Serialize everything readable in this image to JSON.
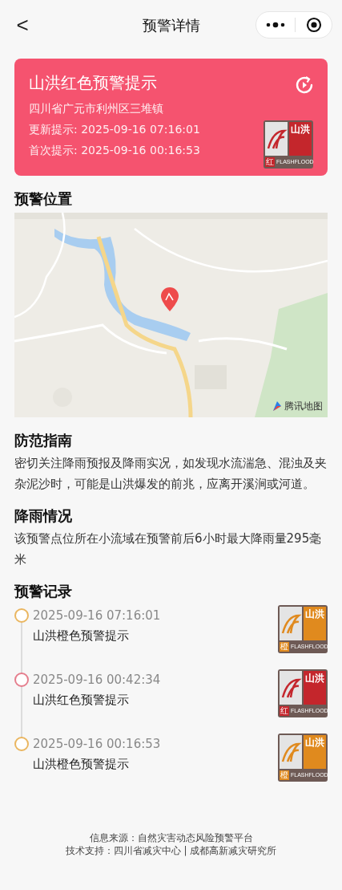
{
  "nav": {
    "back": "<",
    "title": "预警详情"
  },
  "alert": {
    "kind": "red",
    "title": "山洪红色预警提示",
    "location": "四川省广元市利州区三堆镇",
    "updated": "更新提示: 2025-09-16 07:16:01",
    "first": "首次提示: 2025-09-16 00:16:53",
    "badge": {
      "name": "山洪",
      "level": "红",
      "en": "FLASHFLOOD"
    }
  },
  "map_section": {
    "title": "预警位置",
    "map_logo": "腾讯地图"
  },
  "guide": {
    "title": "防范指南",
    "text": "密切关注降雨预报及降雨实况，如发现水流湍急、混浊及夹杂泥沙时，可能是山洪爆发的前兆，应离开溪涧或河道。"
  },
  "rain": {
    "title": "降雨情况",
    "text": "该预警点位所在小流域在预警前后6小时最大降雨量295毫米"
  },
  "records": {
    "title": "预警记录",
    "items": [
      {
        "kind": "orange",
        "time": "2025-09-16 07:16:01",
        "label": "山洪橙色预警提示",
        "badge": {
          "name": "山洪",
          "level": "橙",
          "en": "FLASHFLOOD"
        }
      },
      {
        "kind": "red",
        "time": "2025-09-16 00:42:34",
        "label": "山洪红色预警提示",
        "badge": {
          "name": "山洪",
          "level": "红",
          "en": "FLASHFLOOD"
        }
      },
      {
        "kind": "orange",
        "time": "2025-09-16 00:16:53",
        "label": "山洪橙色预警提示",
        "badge": {
          "name": "山洪",
          "level": "橙",
          "en": "FLASHFLOOD"
        }
      }
    ]
  },
  "footer": [
    "信息来源：自然灾害动态风险预警平台",
    "技术支持：四川省减灾中心 | 成都高新减灾研究所"
  ]
}
